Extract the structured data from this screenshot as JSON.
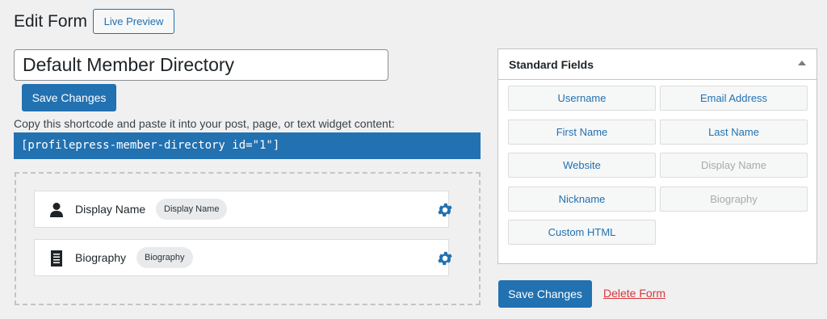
{
  "header": {
    "title": "Edit Form",
    "live_preview_label": "Live Preview"
  },
  "form": {
    "title_value": "Default Member Directory",
    "save_label": "Save Changes",
    "shortcode_hint": "Copy this shortcode and paste it into your post, page, or text widget content:",
    "shortcode": "[profilepress-member-directory id=\"1\"]"
  },
  "builder": {
    "fields": [
      {
        "label": "Display Name",
        "tag": "Display Name",
        "icon": "user-icon"
      },
      {
        "label": "Biography",
        "tag": "Biography",
        "icon": "document-icon"
      }
    ]
  },
  "standard_fields": {
    "title": "Standard Fields",
    "items": [
      {
        "label": "Username",
        "enabled": true
      },
      {
        "label": "Email Address",
        "enabled": true
      },
      {
        "label": "First Name",
        "enabled": true
      },
      {
        "label": "Last Name",
        "enabled": true
      },
      {
        "label": "Website",
        "enabled": true
      },
      {
        "label": "Display Name",
        "enabled": false
      },
      {
        "label": "Nickname",
        "enabled": true
      },
      {
        "label": "Biography",
        "enabled": false
      },
      {
        "label": "Custom HTML",
        "enabled": true
      }
    ]
  },
  "footer": {
    "save_label": "Save Changes",
    "delete_label": "Delete Form"
  },
  "colors": {
    "accent": "#2271b1",
    "danger": "#d63638",
    "background": "#f0f0f1"
  }
}
